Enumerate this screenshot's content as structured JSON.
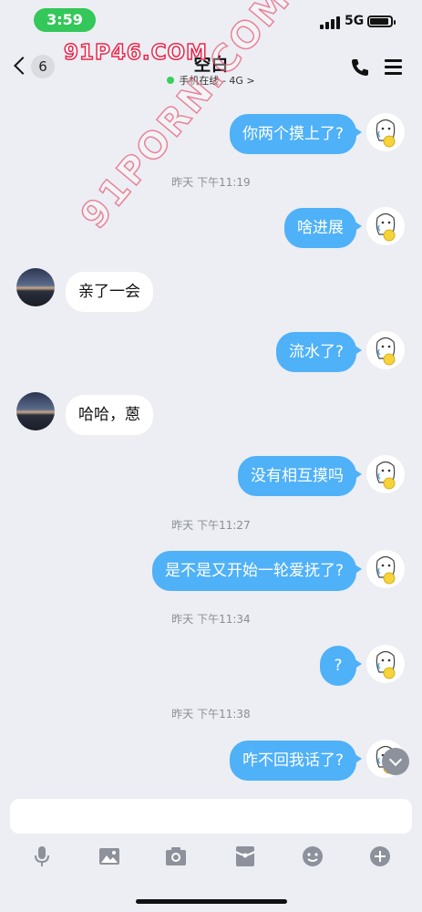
{
  "status_bar": {
    "time": "3:59",
    "network": "5G"
  },
  "header": {
    "back_count": "6",
    "title": "空白",
    "online_status": "手机在线 - 4G",
    "online_chevron": ">"
  },
  "watermark": {
    "top": "91P46.COM",
    "diagonal": "91PORN.COM"
  },
  "messages": [
    {
      "side": "out",
      "text": "你两个摸上了?"
    },
    {
      "type": "time",
      "text": "昨天 下午11:19"
    },
    {
      "side": "out",
      "text": "啥进展"
    },
    {
      "side": "in",
      "text": "亲了一会"
    },
    {
      "side": "out",
      "text": "流水了?"
    },
    {
      "side": "in",
      "text": "哈哈，蒽"
    },
    {
      "side": "out",
      "text": "没有相互摸吗"
    },
    {
      "type": "time",
      "text": "昨天 下午11:27"
    },
    {
      "side": "out",
      "text": "是不是又开始一轮爱抚了?"
    },
    {
      "type": "time",
      "text": "昨天 下午11:34"
    },
    {
      "side": "out",
      "text": "?"
    },
    {
      "type": "time",
      "text": "昨天 下午11:38"
    },
    {
      "side": "out",
      "text": "咋不回我话了?"
    }
  ],
  "input": {
    "placeholder": ""
  },
  "toolbar": [
    "microphone-icon",
    "image-icon",
    "camera-icon",
    "red-packet-icon",
    "emoji-icon",
    "plus-icon"
  ],
  "colors": {
    "bubble_out": "#4fb1f7",
    "bubble_in": "#ffffff",
    "background": "#eceef3",
    "online": "#3ccf5f",
    "time_pill": "#34c759"
  }
}
